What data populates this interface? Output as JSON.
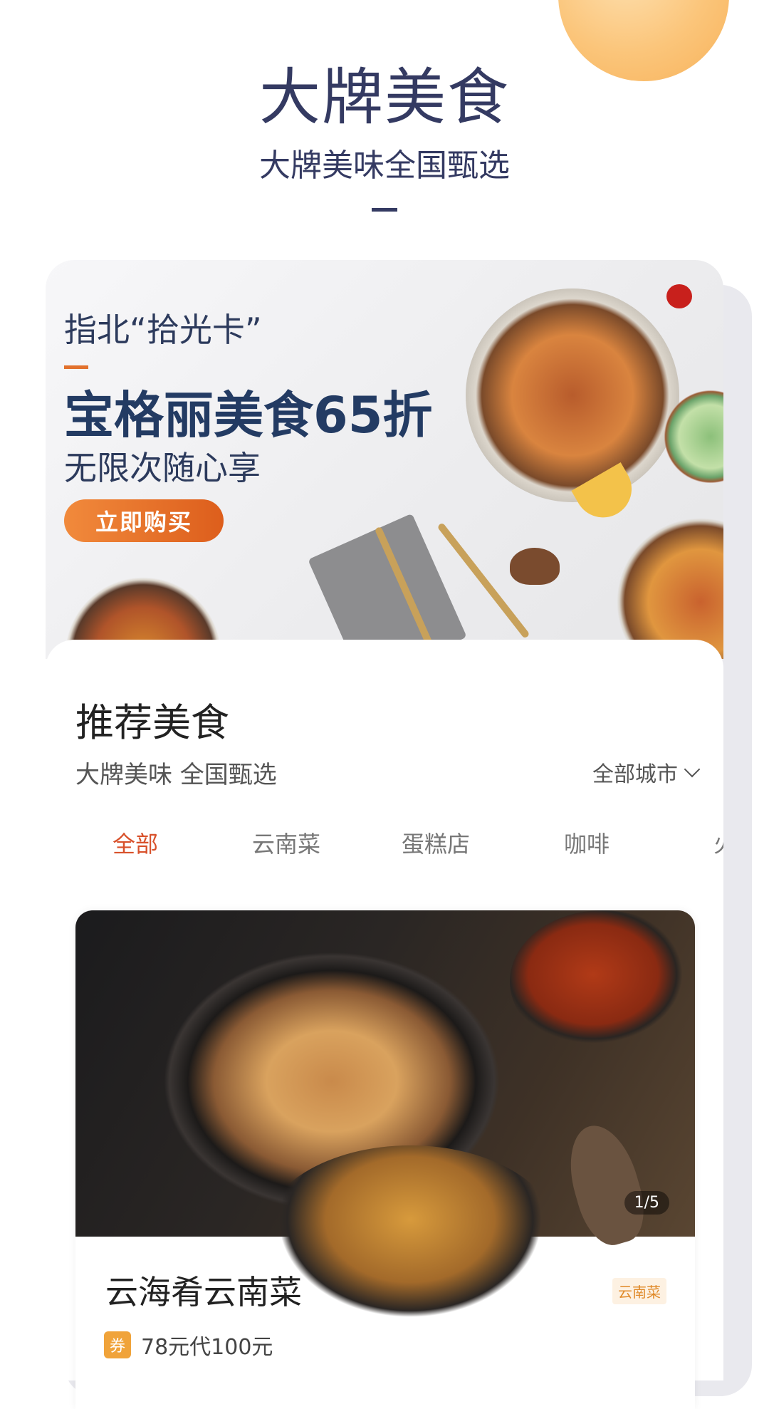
{
  "header": {
    "title": "大牌美食",
    "subtitle": "大牌美味全国甄选"
  },
  "banner": {
    "line1": "指北“拾光卡”",
    "headline": "宝格丽美食65折",
    "line2": "无限次随心享",
    "cta": "立即购买"
  },
  "section": {
    "title": "推荐美食",
    "tagline": "大牌美味 全国甄选",
    "city_filter": "全部城市"
  },
  "tabs": [
    {
      "label": "全部",
      "active": true
    },
    {
      "label": "云南菜",
      "active": false
    },
    {
      "label": "蛋糕店",
      "active": false
    },
    {
      "label": "咖啡",
      "active": false
    },
    {
      "label": "火",
      "active": false
    }
  ],
  "food_card": {
    "image_counter": "1/5",
    "name": "云海肴云南菜",
    "category_tag": "云南菜",
    "coupon_badge": "券",
    "coupon_text": "78元代100元"
  },
  "colors": {
    "accent": "#d8512b",
    "title": "#343a62",
    "cta_start": "#f18a3c",
    "cta_end": "#dd5e1c",
    "coupon": "#f0a33a"
  }
}
